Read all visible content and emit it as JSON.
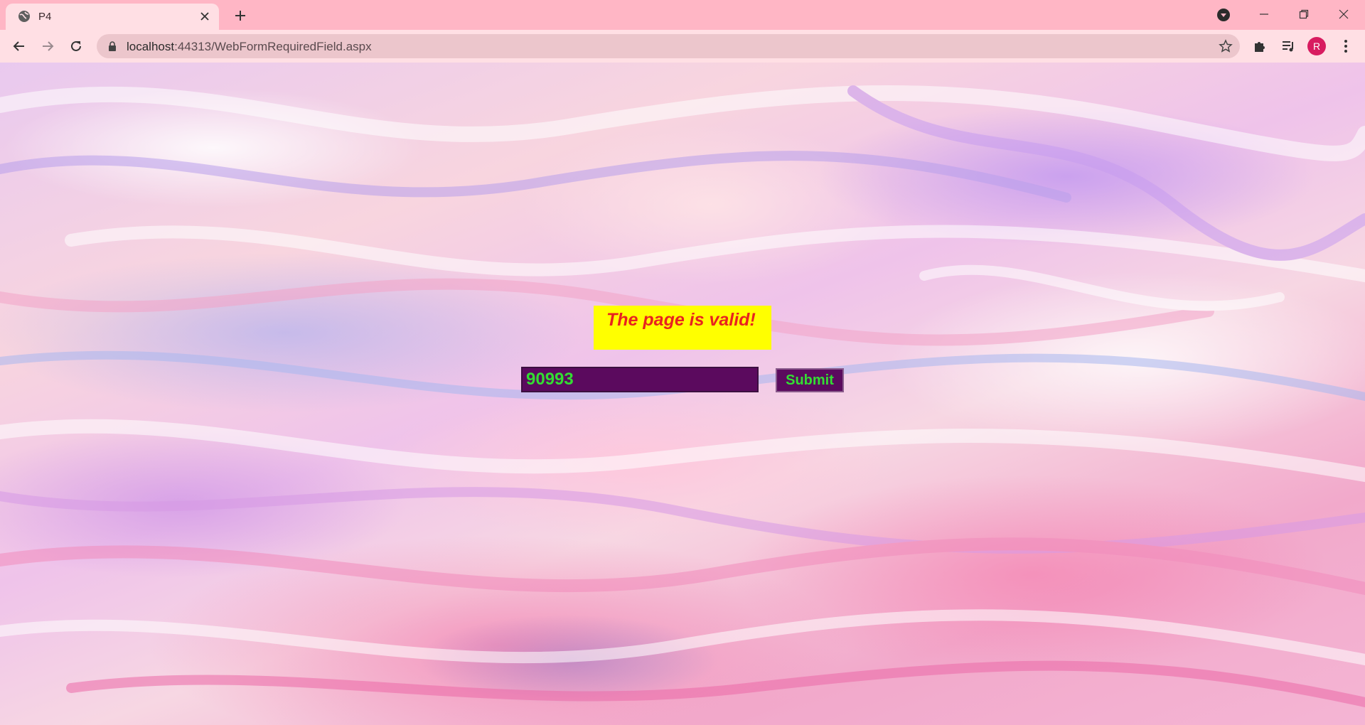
{
  "browser": {
    "tab": {
      "title": "P4",
      "favicon": "globe-icon",
      "close": "close-icon"
    },
    "new_tab": "plus-icon",
    "tab_search": "chevron-down-icon",
    "window_controls": [
      "minimize-icon",
      "restore-icon",
      "close-icon"
    ],
    "toolbar": {
      "back": "arrow-left-icon",
      "forward": "arrow-right-icon",
      "reload": "reload-icon",
      "url_host": "localhost",
      "url_path": ":44313/WebFormRequiredField.aspx",
      "bookmark": "star-icon",
      "extensions": "puzzle-icon",
      "media": "playlist-icon",
      "profile_initial": "R",
      "menu": "kebab-menu-icon"
    },
    "colors": {
      "tabstrip_bg": "#ffb6c5",
      "toolbar_bg": "#ffdfe4",
      "avatar_bg": "#d81b60"
    }
  },
  "page": {
    "validation_message": "The page is valid!",
    "input_value": "90993",
    "submit_label": "Submit",
    "colors": {
      "message_bg": "#ffff00",
      "message_text": "#e8231f",
      "control_bg": "#5b0a5e",
      "control_text": "#33dd33"
    }
  }
}
